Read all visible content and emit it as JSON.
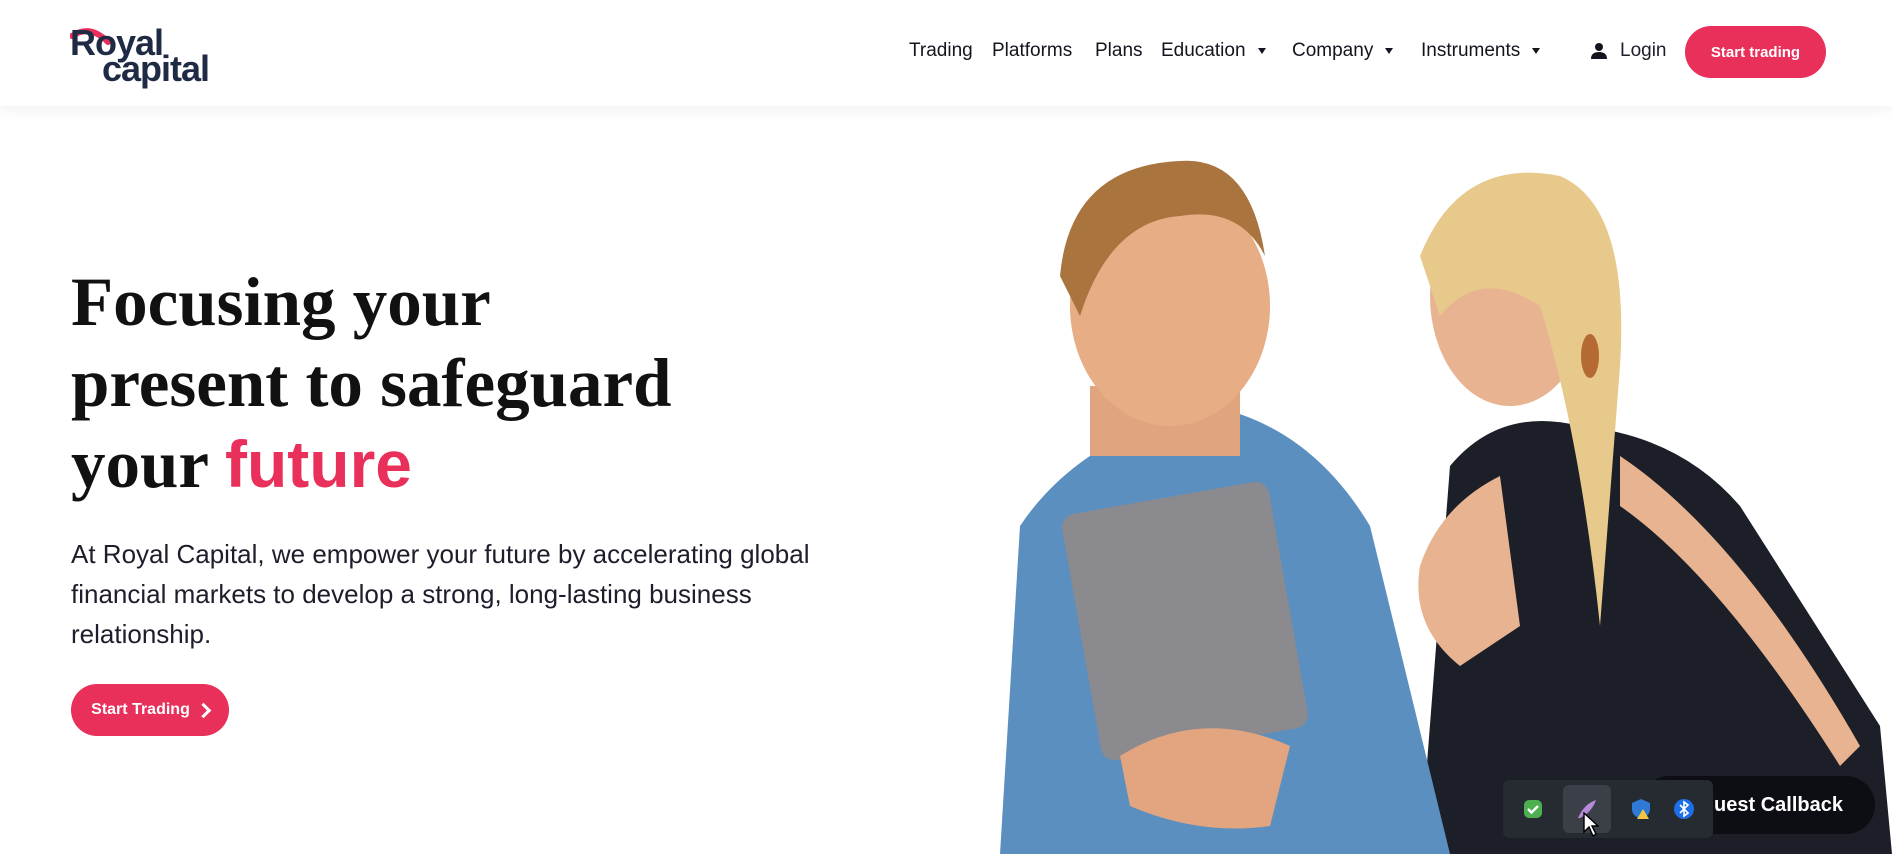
{
  "brand": {
    "line1": "Royal",
    "line2": "capital",
    "accent_color": "#e8305a",
    "navy": "#1f2a44"
  },
  "nav": {
    "items": [
      {
        "label": "Trading",
        "has_dropdown": false
      },
      {
        "label": "Platforms",
        "has_dropdown": false
      },
      {
        "label": "Plans",
        "has_dropdown": false
      },
      {
        "label": "Education",
        "has_dropdown": true
      },
      {
        "label": "Company",
        "has_dropdown": true
      },
      {
        "label": "Instruments",
        "has_dropdown": true
      }
    ],
    "login_label": "Login",
    "cta_label": "Start trading"
  },
  "hero": {
    "headline_l1": "Focusing your",
    "headline_l2": "present to safeguard",
    "headline_l3a": "your",
    "headline_l3b": "future",
    "subtext": "At Royal Capital, we empower your future by accelerating global financial markets to develop a strong, long-lasting business relationship.",
    "cta_label": "Start Trading"
  },
  "callback": {
    "label": "quest Callback"
  },
  "tray": {
    "icons": [
      "security-check-icon",
      "feather-app-icon",
      "defender-warning-icon",
      "bluetooth-icon"
    ]
  }
}
